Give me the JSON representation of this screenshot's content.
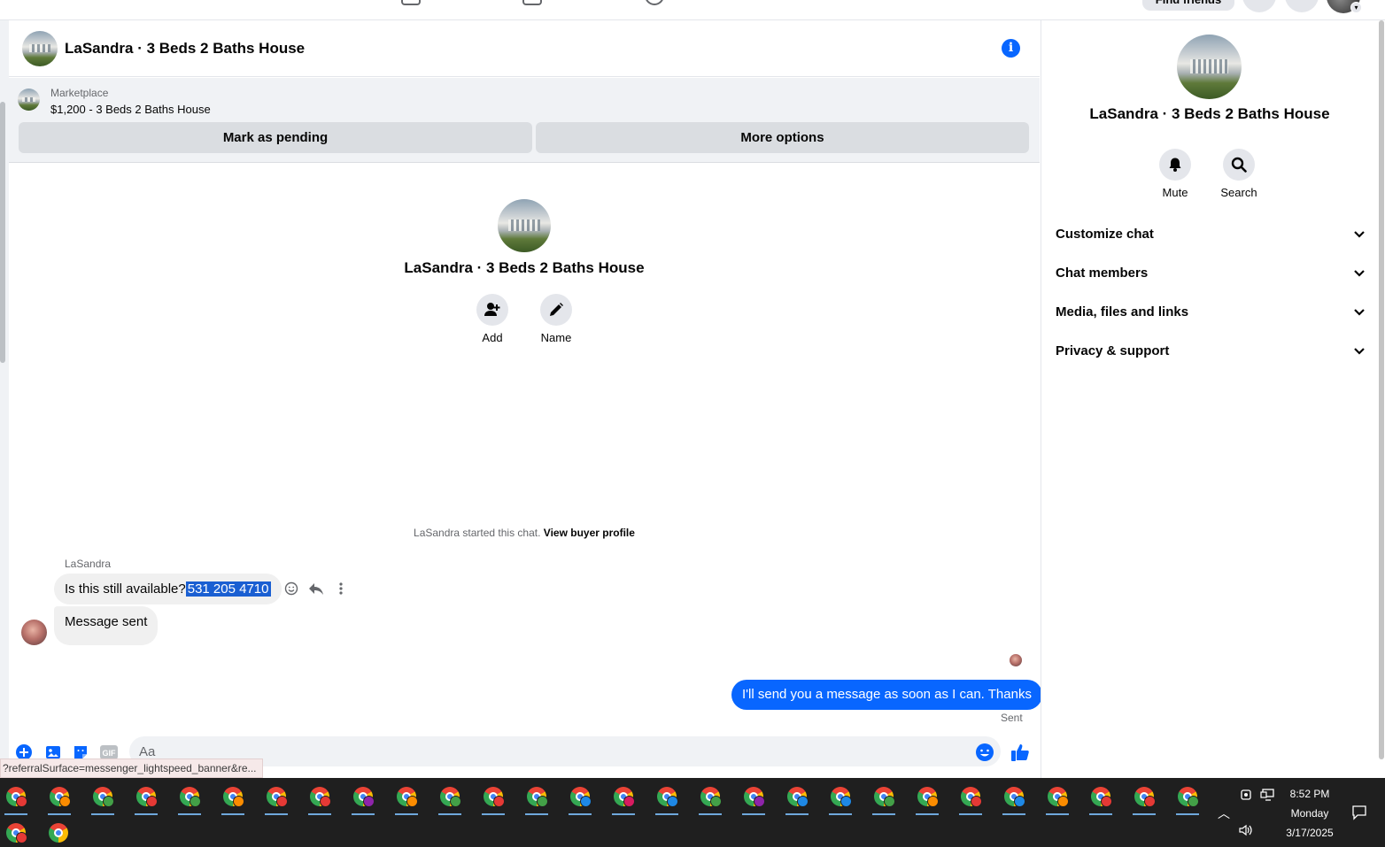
{
  "topbar": {
    "find_friends": "Find friends"
  },
  "chat": {
    "title": "LaSandra · 3 Beds 2 Baths House",
    "info_icon": "info-icon"
  },
  "marketplace": {
    "label": "Marketplace",
    "listing": "$1,200 - 3 Beds 2 Baths House",
    "mark_pending": "Mark as pending",
    "more_options": "More options"
  },
  "intro": {
    "title": "LaSandra · 3 Beds 2 Baths House",
    "add_label": "Add",
    "name_label": "Name",
    "started_text": "LaSandra started this chat.",
    "view_profile": "View buyer profile"
  },
  "messages": {
    "sender": "LaSandra",
    "msg1_text": "Is this still available?",
    "msg1_selected": "531 205 4710",
    "msg2_text": "Message sent",
    "outgoing": "I'll send you a message as soon as I can. Thanks",
    "sent_status": "Sent"
  },
  "composer": {
    "placeholder": "Aa",
    "gif_label": "GIF"
  },
  "status_url": "?referralSurface=messenger_lightspeed_banner&re...",
  "right_panel": {
    "title": "LaSandra · 3 Beds 2 Baths House",
    "mute": "Mute",
    "search": "Search",
    "sections": [
      "Customize chat",
      "Chat members",
      "Media, files and links",
      "Privacy & support"
    ]
  },
  "taskbar": {
    "time": "8:52 PM",
    "day": "Monday",
    "date": "3/17/2025",
    "profile_colors": [
      "#e53935",
      "#fb8c00",
      "#43a047",
      "#e53935",
      "#43a047",
      "#fb8c00",
      "#e53935",
      "#e53935",
      "#8e24aa",
      "#fb8c00",
      "#43a047",
      "#e53935",
      "#43a047",
      "#1e88e5",
      "#d81b60",
      "#1e88e5",
      "#43a047",
      "#8e24aa",
      "#1e88e5",
      "#1e88e5",
      "#43a047",
      "#fb8c00",
      "#e53935",
      "#1e88e5",
      "#fb8c00",
      "#e53935",
      "#e53935",
      "#43a047"
    ]
  },
  "colors": {
    "accent": "#0866ff",
    "bubble_in": "#f0f0f0",
    "selection": "#1a5fd2"
  }
}
